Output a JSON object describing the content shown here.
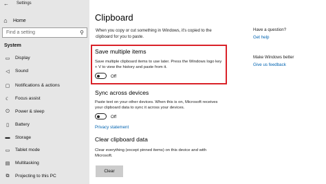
{
  "window": {
    "title": "Settings"
  },
  "sidebar": {
    "home_label": "Home",
    "search_placeholder": "Find a setting",
    "section_label": "System",
    "items": [
      {
        "label": "Display",
        "icon": "monitor-icon"
      },
      {
        "label": "Sound",
        "icon": "speaker-icon"
      },
      {
        "label": "Notifications & actions",
        "icon": "notifications-icon"
      },
      {
        "label": "Focus assist",
        "icon": "moon-icon"
      },
      {
        "label": "Power & sleep",
        "icon": "power-icon"
      },
      {
        "label": "Battery",
        "icon": "battery-icon"
      },
      {
        "label": "Storage",
        "icon": "storage-icon"
      },
      {
        "label": "Tablet mode",
        "icon": "tablet-icon"
      },
      {
        "label": "Multitasking",
        "icon": "multitasking-icon"
      },
      {
        "label": "Projecting to this PC",
        "icon": "projector-icon"
      }
    ]
  },
  "main": {
    "title": "Clipboard",
    "intro": "When you copy or cut something in Windows, it's copied to the clipboard for you to paste.",
    "save_multiple": {
      "heading": "Save multiple items",
      "description": "Save multiple clipboard items to use later. Press the Windows logo key + V to view the history and paste from it.",
      "toggle_state": "Off"
    },
    "sync": {
      "heading": "Sync across devices",
      "description": "Paste text on your other devices. When this is on, Microsoft receives your clipboard data to sync it across your devices.",
      "toggle_state": "Off",
      "privacy_link": "Privacy statement"
    },
    "clear": {
      "heading": "Clear clipboard data",
      "description": "Clear everything (except pinned items) on this device and with Microsoft.",
      "button_label": "Clear"
    }
  },
  "aside": {
    "question_heading": "Have a question?",
    "help_link": "Get help",
    "better_heading": "Make Windows better",
    "feedback_link": "Give us feedback"
  },
  "colors": {
    "accent": "#0078d7",
    "link": "#0063b1",
    "highlight": "#d92027"
  }
}
